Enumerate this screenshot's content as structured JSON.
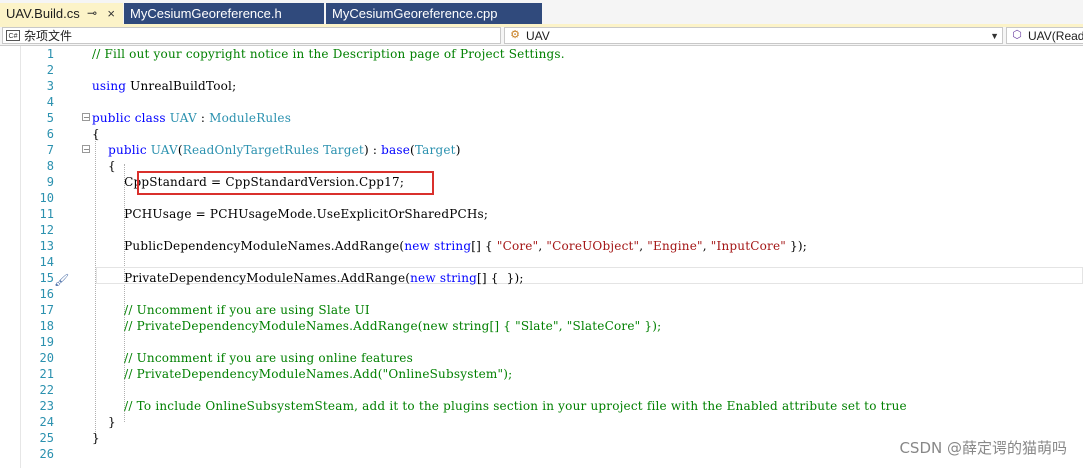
{
  "tabs": [
    {
      "label": "UAV.Build.cs",
      "active": true,
      "pin_icon": "pin-icon",
      "close_icon": "close-icon"
    },
    {
      "label": "MyCesiumGeoreference.h",
      "active": false
    },
    {
      "label": "MyCesiumGeoreference.cpp",
      "active": false
    }
  ],
  "navbar": {
    "project": {
      "icon_text": "C#",
      "label": "杂项文件"
    },
    "class": {
      "label": "UAV"
    },
    "member": {
      "label": "UAV(Read"
    }
  },
  "code_lines": [
    {
      "n": "1",
      "text": "// Fill out your copyright notice in the Description page of Project Settings."
    },
    {
      "n": "2",
      "text": ""
    },
    {
      "n": "3",
      "text": "using UnrealBuildTool;"
    },
    {
      "n": "4",
      "text": ""
    },
    {
      "n": "5",
      "text": "public class UAV : ModuleRules"
    },
    {
      "n": "6",
      "text": "{"
    },
    {
      "n": "7",
      "text": "    public UAV(ReadOnlyTargetRules Target) : base(Target)"
    },
    {
      "n": "8",
      "text": "    {"
    },
    {
      "n": "9",
      "text": "        CppStandard = CppStandardVersion.Cpp17;"
    },
    {
      "n": "10",
      "text": ""
    },
    {
      "n": "11",
      "text": "        PCHUsage = PCHUsageMode.UseExplicitOrSharedPCHs;"
    },
    {
      "n": "12",
      "text": ""
    },
    {
      "n": "13",
      "text": "        PublicDependencyModuleNames.AddRange(new string[] { \"Core\", \"CoreUObject\", \"Engine\", \"InputCore\" });"
    },
    {
      "n": "14",
      "text": ""
    },
    {
      "n": "15",
      "text": "        PrivateDependencyModuleNames.AddRange(new string[] {  });"
    },
    {
      "n": "16",
      "text": ""
    },
    {
      "n": "17",
      "text": "        // Uncomment if you are using Slate UI"
    },
    {
      "n": "18",
      "text": "        // PrivateDependencyModuleNames.AddRange(new string[] { \"Slate\", \"SlateCore\" });"
    },
    {
      "n": "19",
      "text": ""
    },
    {
      "n": "20",
      "text": "        // Uncomment if you are using online features"
    },
    {
      "n": "21",
      "text": "        // PrivateDependencyModuleNames.Add(\"OnlineSubsystem\");"
    },
    {
      "n": "22",
      "text": ""
    },
    {
      "n": "23",
      "text": "        // To include OnlineSubsystemSteam, add it to the plugins section in your uproject file with the Enabled attribute set to true"
    },
    {
      "n": "24",
      "text": "    }"
    },
    {
      "n": "25",
      "text": "}"
    },
    {
      "n": "26",
      "text": ""
    }
  ],
  "watermark": "CSDN @薛定谔的猫萌吗",
  "colors": {
    "keyword": "#0000ff",
    "type": "#2b91af",
    "comment": "#008000",
    "string": "#a31515",
    "highlight_box": "#d9302c"
  }
}
